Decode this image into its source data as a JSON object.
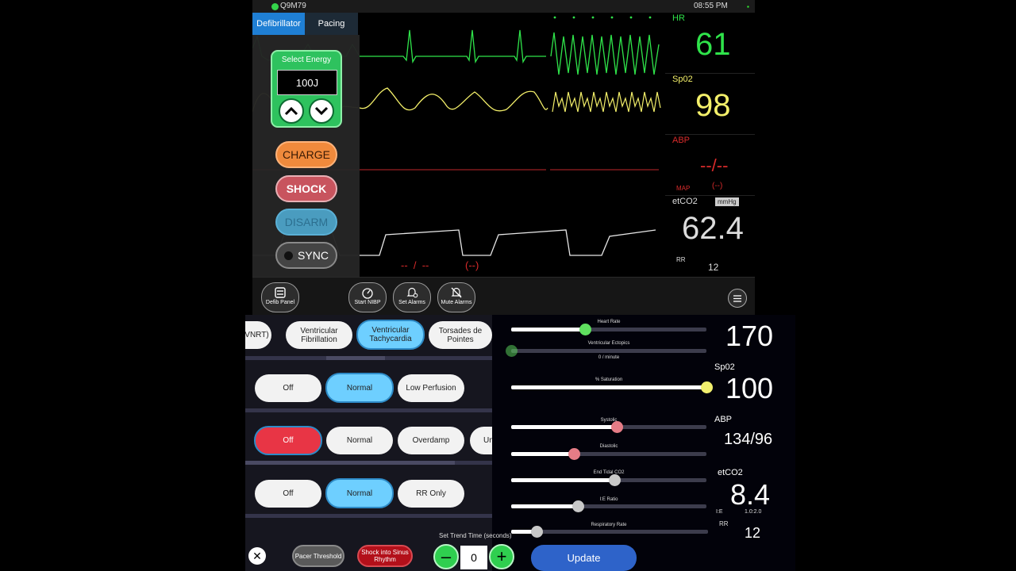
{
  "status": {
    "device_id": "Q9M79",
    "time": "08:55 PM"
  },
  "tabs": {
    "defibrillator": "Defibrillator",
    "pacing": "Pacing"
  },
  "defib": {
    "select_energy": "Select Energy",
    "energy": "100J",
    "charge": "CHARGE",
    "shock": "SHOCK",
    "disarm": "DISARM",
    "sync": "SYNC"
  },
  "vitals": {
    "hr_label": "HR",
    "hr_value": "61",
    "spo2_label": "Sp02",
    "spo2_value": "98",
    "abp_label": "ABP",
    "abp_value": "--/--",
    "map_label": "MAP",
    "map_value": "(--)",
    "etco2_label": "etCO2",
    "etco2_unit": "mmHg",
    "etco2_value": "62.4",
    "rr_label": "RR",
    "rr_value": "12",
    "nibp_readout": "--  /  --",
    "nibp_map": "(--)"
  },
  "nav": {
    "defib_panel": "Defib Panel",
    "start_nibp": "Start NIBP",
    "set_alarms": "Set Alarms",
    "mute_alarms": "Mute Alarms"
  },
  "rhythms": [
    "AVNRT)",
    "Ventricular Fibrillation",
    "Ventricular Tachycardia",
    "Torsades de Pointes"
  ],
  "spo2_options": [
    "Off",
    "Normal",
    "Low Perfusion"
  ],
  "abp_options": [
    "Off",
    "Normal",
    "Overdamp",
    "Un"
  ],
  "etco2_options": [
    "Off",
    "Normal",
    "RR Only"
  ],
  "bottom_buttons": {
    "pacer": "Pacer Threshold",
    "shock_sinus": "Shock into Sinus Rhythm"
  },
  "settings": {
    "heart_rate_label": "Heart Rate",
    "ectopics_label": "Ventricular Ectopics",
    "ectopics_value": "0  / minute",
    "saturation_label": "% Saturation",
    "systolic_label": "Systolic",
    "diastolic_label": "Diastolic",
    "etco2_label": "End Tidal CO2",
    "ie_label": "I:E Ratio",
    "resp_label": "Respiratory Rate",
    "hr_value": "170",
    "spo2_label": "Sp02",
    "spo2_value": "100",
    "abp_label": "ABP",
    "abp_value": "134/96",
    "etco2_title": "etCO2",
    "etco2_value": "8.4",
    "ie_short": "I:E",
    "ie_value": "1.0:2.0",
    "rr_label": "RR",
    "rr_value": "12",
    "trend_label": "Set Trend Time (seconds)",
    "trend_value": "0",
    "update": "Update",
    "minus": "–",
    "plus": "+",
    "close": "✕"
  },
  "sliders": {
    "heart_rate": 0.38,
    "ectopics": 0.0,
    "saturation": 1.0,
    "systolic": 0.54,
    "diastolic": 0.32,
    "etco2": 0.53,
    "ie": 0.34,
    "resp": 0.13
  },
  "colors": {
    "hr": "#2fe34a",
    "spo2": "#f4f06a",
    "abp": "#d92b2b",
    "etco2": "#dddddd",
    "hr_knob": "#5fe05f",
    "spo2_knob": "#f2f06e",
    "abp_knob": "#e57c86",
    "etco2_knob": "#c8c8c8"
  }
}
